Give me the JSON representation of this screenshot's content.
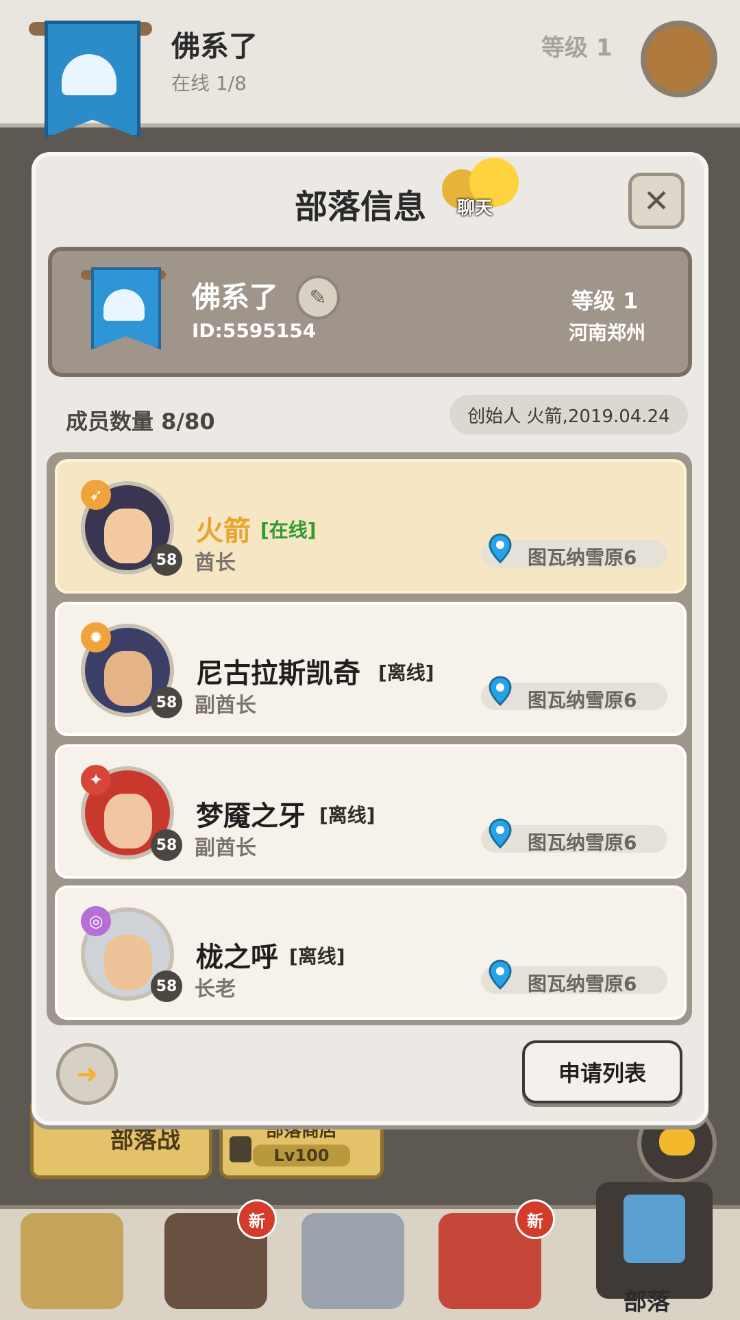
{
  "header": {
    "tribe_name": "佛系了",
    "online": "在线 1/8",
    "level": "等级 1"
  },
  "background_buttons": {
    "tribe_war": "部落战",
    "tribe_shop": "部落商店",
    "shop_lock_level": "Lv100"
  },
  "bottom_nav": {
    "active_label": "部落",
    "new_badge": "新"
  },
  "dialog": {
    "title": "部落信息",
    "chat_label": "聊天",
    "close": "✕",
    "tribe": {
      "name": "佛系了",
      "id": "ID:5595154",
      "level": "等级 1",
      "region": "河南郑州"
    },
    "member_count": "成员数量 8/80",
    "founder": "创始人 火箭,2019.04.24",
    "members": [
      {
        "name": "火箭",
        "status": "[在线]",
        "role": "酋长",
        "level": "58",
        "location": "图瓦纳雪原6",
        "highlight": true
      },
      {
        "name": "尼古拉斯凯奇",
        "status": "[离线]",
        "role": "副酋长",
        "level": "58",
        "location": "图瓦纳雪原6",
        "highlight": false
      },
      {
        "name": "梦魇之牙",
        "status": "[离线]",
        "role": "副酋长",
        "level": "58",
        "location": "图瓦纳雪原6",
        "highlight": false
      },
      {
        "name": "栊之呼",
        "status": "[离线]",
        "role": "长老",
        "level": "58",
        "location": "图瓦纳雪原6",
        "highlight": false
      }
    ],
    "apply_list": "申请列表"
  },
  "colors": {
    "online_name": "#e7a52e",
    "online_status": "#2f9b2f",
    "banner_blue": "#2c8bc9",
    "pin_blue": "#2aa3e6"
  }
}
